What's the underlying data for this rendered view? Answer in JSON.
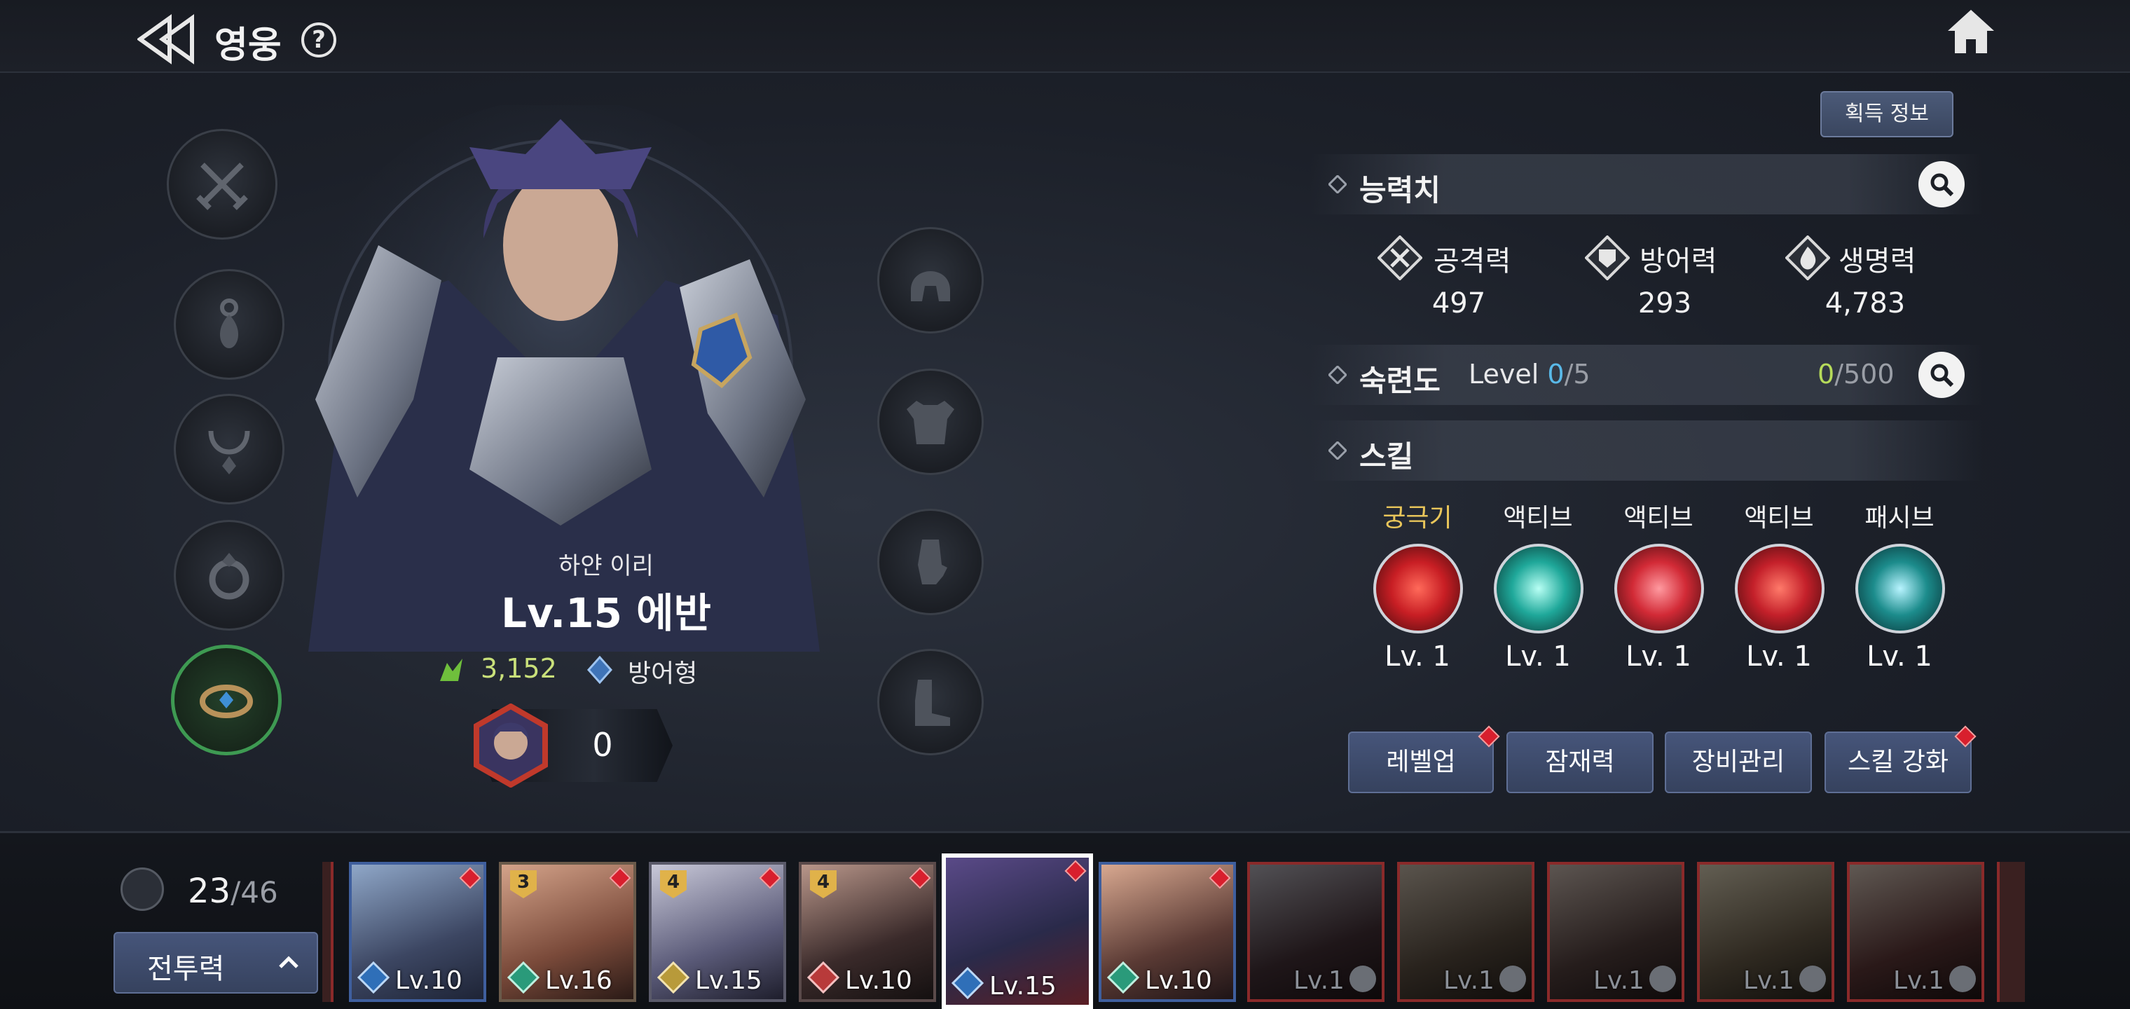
{
  "header": {
    "title": "영웅",
    "help": "?"
  },
  "hero": {
    "subtitle": "하얀 이리",
    "name": "Lv.15 에반",
    "power": "3,152",
    "type": "방어형",
    "stars": "0"
  },
  "panel": {
    "acquire_label": "획득 정보",
    "stats_title": "능력치",
    "stats": [
      {
        "name": "공격력",
        "value": "497",
        "icon": "attack-icon"
      },
      {
        "name": "방어력",
        "value": "293",
        "icon": "defense-icon"
      },
      {
        "name": "생명력",
        "value": "4,783",
        "icon": "life-icon"
      }
    ],
    "mastery_title": "숙련도",
    "mastery_level_label": "Level",
    "mastery_level_cur": "0",
    "mastery_level_max": "/5",
    "mastery_exp_cur": "0",
    "mastery_exp_max": "/500",
    "skills_title": "스킬",
    "skills": [
      {
        "type": "궁극기",
        "level": "Lv. 1",
        "color": "#c81e24"
      },
      {
        "type": "액티브",
        "level": "Lv. 1",
        "color": "#1fa89a"
      },
      {
        "type": "액티브",
        "level": "Lv. 1",
        "color": "#d22a36"
      },
      {
        "type": "액티브",
        "level": "Lv. 1",
        "color": "#c4202a"
      },
      {
        "type": "패시브",
        "level": "Lv. 1",
        "color": "#1c8c8c"
      }
    ],
    "buttons": {
      "levelup": "레벨업",
      "potential": "잠재력",
      "equip": "장비관리",
      "skill_up": "스킬 강화"
    }
  },
  "roster": {
    "count_cur": "23",
    "count_max": "/46",
    "sort_label": "전투력",
    "cards": [
      {
        "level": "Lv.10",
        "stars": ""
      },
      {
        "level": "Lv.16",
        "stars": "3"
      },
      {
        "level": "Lv.15",
        "stars": "4"
      },
      {
        "level": "Lv.10",
        "stars": "4"
      },
      {
        "level": "Lv.15",
        "stars": ""
      },
      {
        "level": "Lv.10",
        "stars": ""
      },
      {
        "level": "Lv.1",
        "stars": ""
      },
      {
        "level": "Lv.1",
        "stars": ""
      },
      {
        "level": "Lv.1",
        "stars": ""
      },
      {
        "level": "Lv.1",
        "stars": ""
      },
      {
        "level": "Lv.1",
        "stars": ""
      }
    ]
  },
  "colors": {
    "accent_blue": "#46557a",
    "power_green": "#c9e07a",
    "alert_red": "#d81f2d"
  }
}
